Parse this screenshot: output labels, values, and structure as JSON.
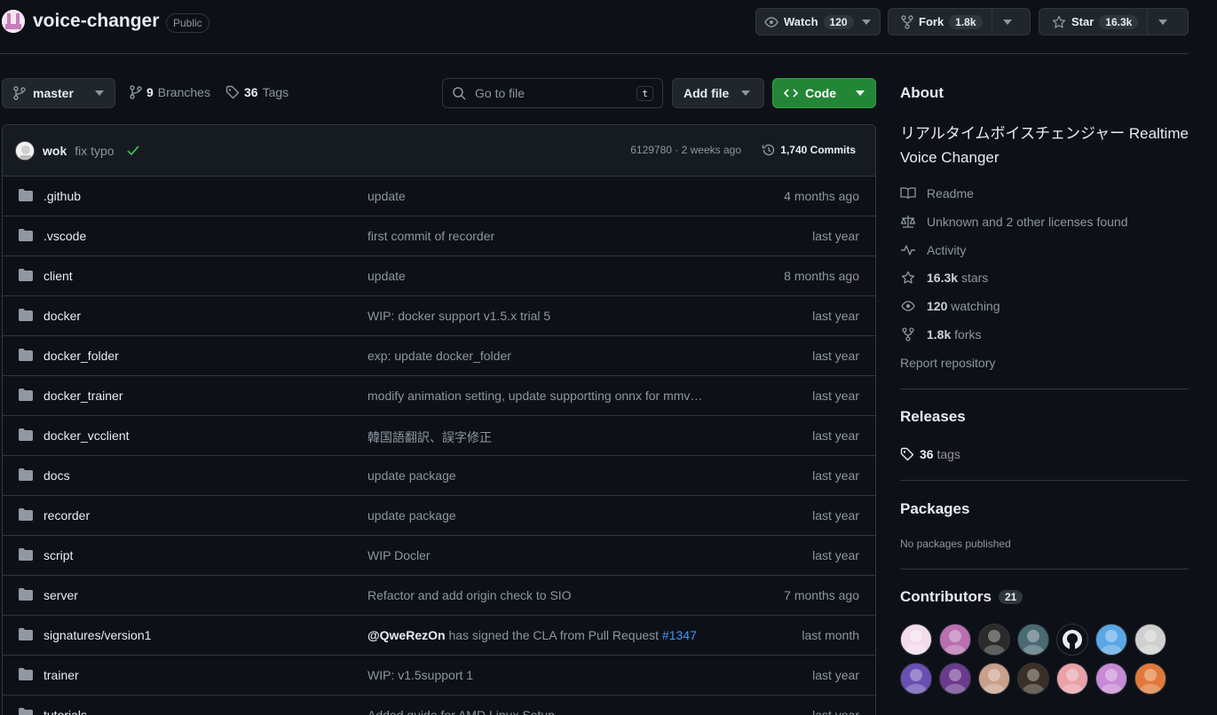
{
  "header": {
    "repo_name": "voice-changer",
    "visibility": "Public",
    "watch_label": "Watch",
    "watch_count": "120",
    "fork_label": "Fork",
    "fork_count": "1.8k",
    "star_label": "Star",
    "star_count": "16.3k"
  },
  "toolbar": {
    "branch": "master",
    "branches_count": "9",
    "branches_label": "Branches",
    "tags_count": "36",
    "tags_label": "Tags",
    "search_placeholder": "Go to file",
    "search_shortcut": "t",
    "add_file_label": "Add file",
    "code_label": "Code"
  },
  "latest_commit": {
    "author": "wok",
    "message": "fix typo",
    "meta": "6129780 · 2 weeks ago",
    "commits_label": "1,740 Commits"
  },
  "files": [
    {
      "name": ".github",
      "message": "update",
      "date": "4 months ago"
    },
    {
      "name": ".vscode",
      "message": "first commit of recorder",
      "date": "last year"
    },
    {
      "name": "client",
      "message": "update",
      "date": "8 months ago"
    },
    {
      "name": "docker",
      "message": "WIP: docker support v1.5.x trial 5",
      "date": "last year"
    },
    {
      "name": "docker_folder",
      "message": "exp: update docker_folder",
      "date": "last year"
    },
    {
      "name": "docker_trainer",
      "message": "modify animation setting, update supportting onnx for mmv…",
      "date": "last year"
    },
    {
      "name": "docker_vcclient",
      "message": "韓国語翻訳、誤字修正",
      "date": "last year"
    },
    {
      "name": "docs",
      "message": "update package",
      "date": "last year"
    },
    {
      "name": "recorder",
      "message": "update package",
      "date": "last year"
    },
    {
      "name": "script",
      "message": "WIP Docler",
      "date": "last year"
    },
    {
      "name": "server",
      "message": "Refactor and add origin check to SIO",
      "date": "7 months ago"
    },
    {
      "name": "signatures/version1",
      "message_user": "@QweRezOn",
      "message_mid": " has signed the CLA from Pull Request ",
      "message_link": "#1347",
      "date": "last month"
    },
    {
      "name": "trainer",
      "message": "WIP: v1.5support 1",
      "date": "last year"
    },
    {
      "name": "tutorials",
      "message": "Added guide for AMD Linux Setup",
      "date": "last year"
    }
  ],
  "about": {
    "heading": "About",
    "description": "リアルタイムボイスチェンジャー Realtime Voice Changer",
    "readme": "Readme",
    "license": "Unknown and 2 other licenses found",
    "activity": "Activity",
    "stars_count": "16.3k",
    "stars_label": "stars",
    "watching_count": "120",
    "watching_label": "watching",
    "forks_count": "1.8k",
    "forks_label": "forks",
    "report": "Report repository"
  },
  "releases": {
    "heading": "Releases",
    "tags_count": "36",
    "tags_label": "tags"
  },
  "packages": {
    "heading": "Packages",
    "empty": "No packages published"
  },
  "contributors": {
    "heading": "Contributors",
    "count": "21",
    "avatar_colors": [
      "#f3dcec",
      "#b96fb0",
      "#2b2b2b",
      "#4a6a73",
      "#0d1117",
      "#5aa7e6",
      "#cfcfcf",
      "#6a4fb3",
      "#6b3a8c",
      "#c9a08b",
      "#3b3026",
      "#e9a2a8",
      "#c78ad6",
      "#e07a3a"
    ]
  },
  "colors": {
    "accent": "#238636",
    "link": "#4493f8",
    "folder": "#9198a1",
    "check": "#3fb950"
  }
}
